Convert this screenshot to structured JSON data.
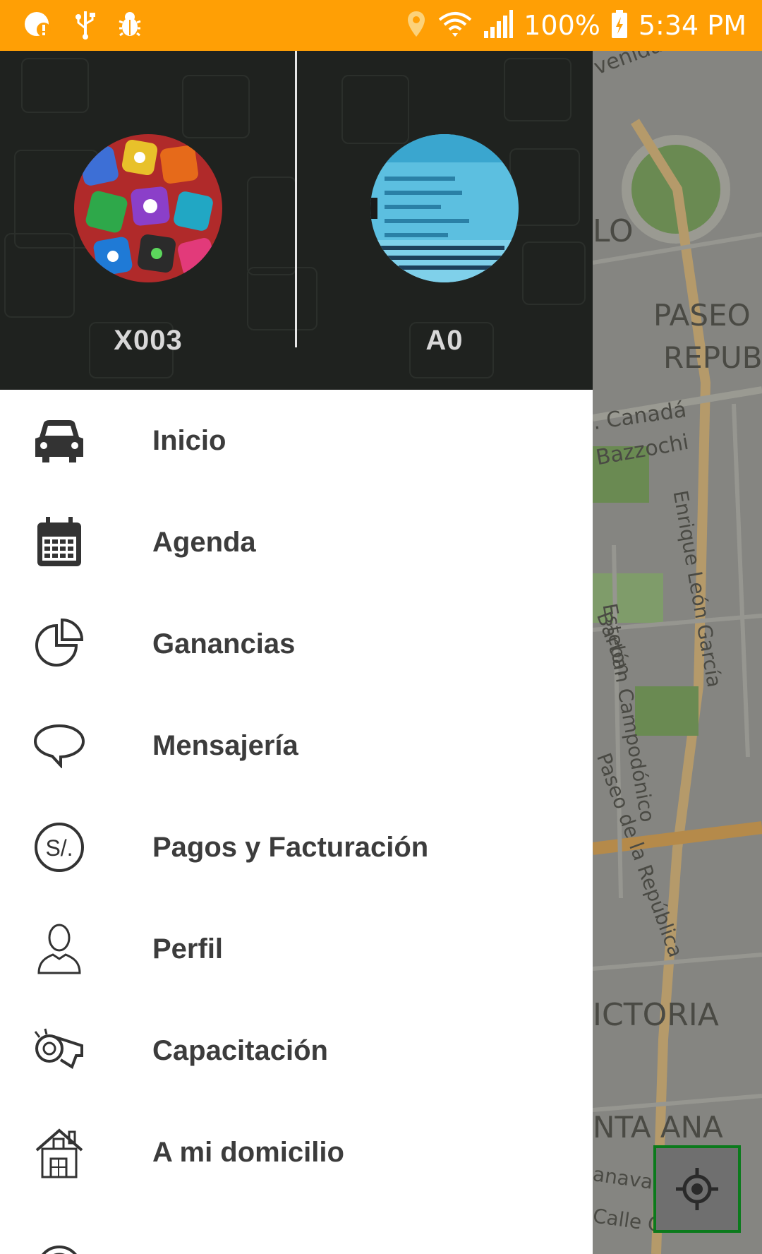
{
  "status_bar": {
    "battery": "100%",
    "time": "5:34 PM",
    "icons": [
      "notification-icon",
      "usb-icon",
      "debug-icon",
      "location-icon",
      "wifi-icon",
      "signal-icon",
      "battery-icon"
    ]
  },
  "drawer": {
    "accounts": [
      {
        "name": "X003",
        "avatar": "apps-collage-avatar"
      },
      {
        "name": "A0",
        "avatar": "id-card-avatar"
      }
    ],
    "menu": [
      {
        "label": "Inicio",
        "icon": "car-icon"
      },
      {
        "label": "Agenda",
        "icon": "calendar-icon"
      },
      {
        "label": "Ganancias",
        "icon": "pie-chart-icon"
      },
      {
        "label": "Mensajería",
        "icon": "chat-bubble-icon"
      },
      {
        "label": "Pagos y Facturación",
        "icon": "currency-soles-icon"
      },
      {
        "label": "Perfil",
        "icon": "person-icon"
      },
      {
        "label": "Capacitación",
        "icon": "whistle-icon"
      },
      {
        "label": "A mi domicilio",
        "icon": "house-icon"
      }
    ]
  },
  "map": {
    "labels": [
      "venida",
      "LO",
      "PASEO D",
      "REPUBL",
      ". Canadá",
      "Bazzochi",
      "Esteban Campodónico",
      "Enrique León García",
      "Bartón",
      "Paseo de la República",
      "ICTORIA",
      "NTA ANA",
      "anava",
      "Calle G"
    ],
    "locate_icon": "crosshair-icon"
  },
  "colors": {
    "status_bar": "#ff9f05",
    "header_bg": "#1f221f",
    "locate_border": "#0b7a1c"
  }
}
